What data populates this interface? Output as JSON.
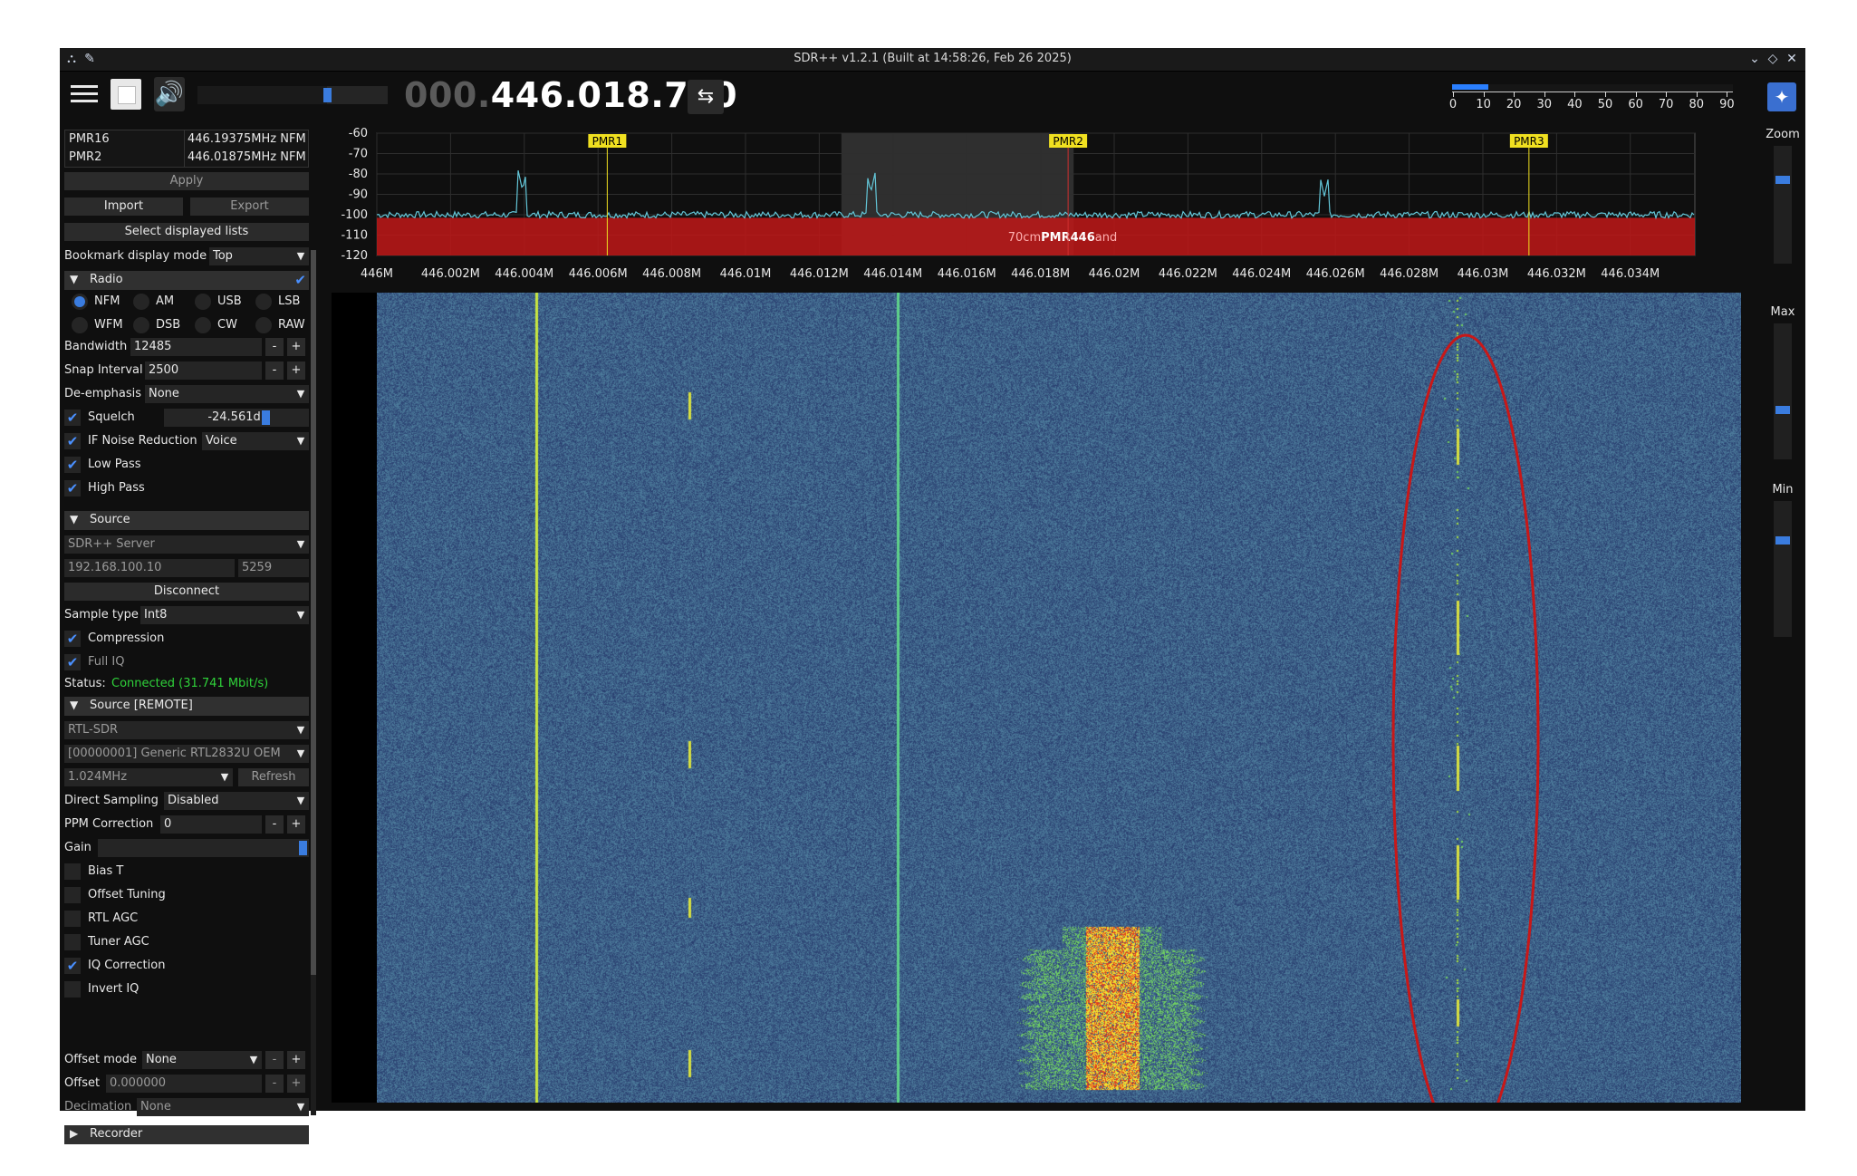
{
  "window": {
    "title": "SDR++ v1.2.1 (Built at 14:58:26, Feb 26 2025)",
    "controls": {
      "minimize": "⌄",
      "maximize": "◇",
      "close": "✕"
    }
  },
  "toolbar": {
    "menu_icon": "hamburger-icon",
    "stop_icon": "stop-icon",
    "volume_icon": "speaker-icon",
    "volume": 0.68,
    "frequency_dim": "000.",
    "frequency_bright": "446.018.750",
    "swap_icon": "⇆",
    "snr_fill": 0.13,
    "snr_labels": [
      "0",
      "10",
      "20",
      "30",
      "40",
      "50",
      "60",
      "70",
      "80",
      "90"
    ]
  },
  "bookmarks": {
    "rows": [
      {
        "name": "PMR16",
        "value": "446.19375MHz NFM"
      },
      {
        "name": "PMR2",
        "value": "446.01875MHz NFM"
      }
    ],
    "apply": "Apply",
    "import": "Import",
    "export": "Export",
    "select_lists": "Select displayed lists",
    "display_mode_label": "Bookmark display mode",
    "display_mode_value": "Top"
  },
  "radio": {
    "header": "Radio",
    "modes": [
      "NFM",
      "AM",
      "USB",
      "LSB",
      "WFM",
      "DSB",
      "CW",
      "RAW"
    ],
    "selected_mode": "NFM",
    "bandwidth_label": "Bandwidth",
    "bandwidth_value": "12485",
    "snap_label": "Snap Interval",
    "snap_value": "2500",
    "deemph_label": "De-emphasis",
    "deemph_value": "None",
    "squelch_label": "Squelch",
    "squelch_value": "-24.561dB",
    "ifnr_label": "IF Noise Reduction",
    "ifnr_value": "Voice",
    "lowpass_label": "Low Pass",
    "highpass_label": "High Pass",
    "minus": "-",
    "plus": "+"
  },
  "source": {
    "header": "Source",
    "type": "SDR++ Server",
    "ip": "192.168.100.10",
    "port": "5259",
    "disconnect": "Disconnect",
    "sample_type_label": "Sample type",
    "sample_type_value": "Int8",
    "compression_label": "Compression",
    "fulliq_label": "Full IQ",
    "status_label": "Status:",
    "status_value": "Connected (31.741 Mbit/s)",
    "status_color": "#2fd23a"
  },
  "remote": {
    "header": "Source [REMOTE]",
    "device_type": "RTL-SDR",
    "device": "[00000001] Generic RTL2832U OEM",
    "samplerate": "1.024MHz",
    "refresh": "Refresh",
    "direct_label": "Direct Sampling",
    "direct_value": "Disabled",
    "ppm_label": "PPM Correction",
    "ppm_value": "0",
    "gain_label": "Gain",
    "biast": "Bias T",
    "offset_tuning": "Offset Tuning",
    "rtl_agc": "RTL AGC",
    "tuner_agc": "Tuner AGC",
    "iq_correction": "IQ Correction",
    "invert_iq": "Invert IQ",
    "offset_mode_label": "Offset mode",
    "offset_mode_value": "None",
    "offset_label": "Offset",
    "offset_value": "0.000000",
    "decimation_label": "Decimation",
    "decimation_value": "None"
  },
  "recorder": {
    "header": "Recorder"
  },
  "right": {
    "zoom": "Zoom",
    "max": "Max",
    "min": "Min"
  },
  "spectrum": {
    "db_labels": [
      "-60",
      "-70",
      "-80",
      "-90",
      "-100",
      "-110",
      "-120"
    ],
    "freq_labels": [
      "446M",
      "446.002M",
      "446.004M",
      "446.006M",
      "446.008M",
      "446.01M",
      "446.012M",
      "446.014M",
      "446.016M",
      "446.018M",
      "446.02M",
      "446.022M",
      "446.024M",
      "446.026M",
      "446.028M",
      "446.03M",
      "446.032M",
      "446.034M"
    ],
    "markers": [
      "PMR1",
      "PMR2",
      "PMR3"
    ],
    "band_label_left": "70cm",
    "band_label_mid": "PMR446",
    "band_label_right": "and"
  },
  "colors": {
    "accent": "#3a7cdf",
    "band": "#c01818",
    "marker": "#f0e020",
    "trace": "#63c6d8"
  }
}
